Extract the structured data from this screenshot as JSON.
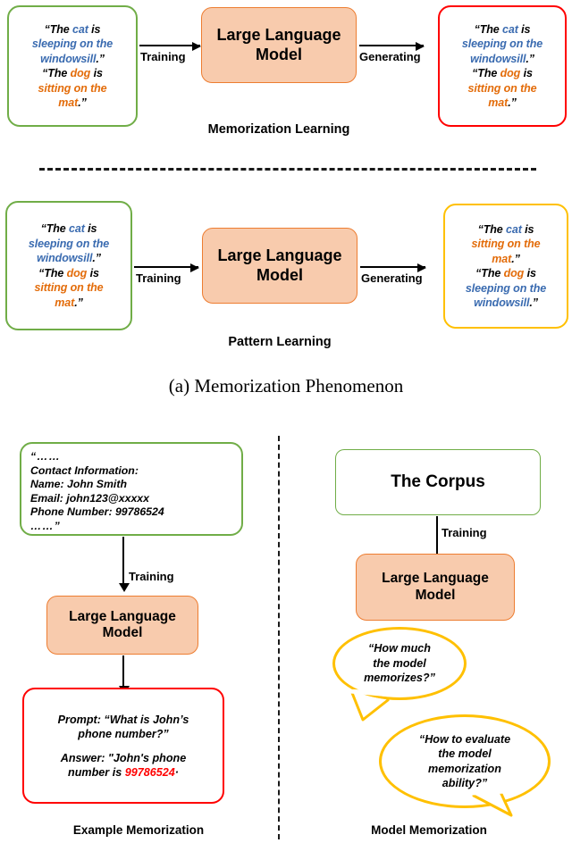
{
  "figure": {
    "caption_a": "(a) Memorization Phenomenon"
  },
  "panel_memorization": {
    "label": "Memorization Learning",
    "input_box": {
      "line1_a": "“The ",
      "line1_b": "cat",
      "line1_c": " is",
      "line2": "sleeping on the",
      "line3_a": "windowsill",
      "line3_b": ".”",
      "line4_a": "“The ",
      "line4_b": "dog",
      "line4_c": " is",
      "line5": "sitting on the",
      "line6_a": "mat",
      "line6_b": ".”"
    },
    "model_label_line1": "Large Language",
    "model_label_line2": "Model",
    "arrow_in_label": "Training",
    "arrow_out_label": "Generating",
    "output_box": {
      "line1_a": "“The ",
      "line1_b": "cat",
      "line1_c": " is",
      "line2": "sleeping on the",
      "line3_a": "windowsill",
      "line3_b": ".”",
      "line4_a": "“The ",
      "line4_b": "dog",
      "line4_c": " is",
      "line5": "sitting on the",
      "line6_a": "mat",
      "line6_b": ".”"
    }
  },
  "panel_pattern": {
    "label": "Pattern Learning",
    "input_box": {
      "line1_a": "“The ",
      "line1_b": "cat",
      "line1_c": " is",
      "line2": "sleeping on the",
      "line3_a": "windowsill",
      "line3_b": ".”",
      "line4_a": "“The ",
      "line4_b": "dog",
      "line4_c": " is",
      "line5": "sitting on the",
      "line6_a": "mat",
      "line6_b": ".”"
    },
    "model_label_line1": "Large Language",
    "model_label_line2": "Model",
    "arrow_in_label": "Training",
    "arrow_out_label": "Generating",
    "output_box": {
      "line1_a": "“The ",
      "line1_b": "cat",
      "line1_c": " is",
      "line2": "sitting on the",
      "line3_a": "mat",
      "line3_b": ".”",
      "line4_a": "“The ",
      "line4_b": "dog",
      "line4_c": " is",
      "line5": "sleeping on the",
      "line6_a": "windowsill",
      "line6_b": ".”"
    }
  },
  "panel_example_memorization": {
    "label": "Example Memorization",
    "document": {
      "l1": "“……",
      "l2": "Contact Information:",
      "l3": "Name: John Smith",
      "l4": "Email: john123@xxxxx",
      "l5": "Phone Number: 99786524",
      "l6": "……”"
    },
    "arrow_label": "Training",
    "model_label_line1": "Large Language",
    "model_label_line2": "Model",
    "prompt": {
      "p1": "Prompt: “What is John’s",
      "p2": "phone number?”",
      "a1": "Answer: \"John's phone",
      "a2_prefix": "number is ",
      "a2_number": "99786524",
      "a2_suffix": "·"
    }
  },
  "panel_model_memorization": {
    "label": "Model Memorization",
    "corpus_label": "The Corpus",
    "arrow_label": "Training",
    "model_label_line1": "Large Language",
    "model_label_line2": "Model",
    "bubble1": {
      "l1": "“How much",
      "l2": "the model",
      "l3": "memorizes?”"
    },
    "bubble2": {
      "l1": "“How to evaluate",
      "l2": "the model",
      "l3": "memorization",
      "l4": "ability?”"
    }
  },
  "colors": {
    "green_border": "#70AD47",
    "red_border": "#FF0000",
    "yellow_border": "#FFC000",
    "model_fill": "#F8CBAD",
    "model_border": "#ED7D31",
    "blue_text": "#3A6BB0",
    "orange_text": "#E36C0A"
  }
}
